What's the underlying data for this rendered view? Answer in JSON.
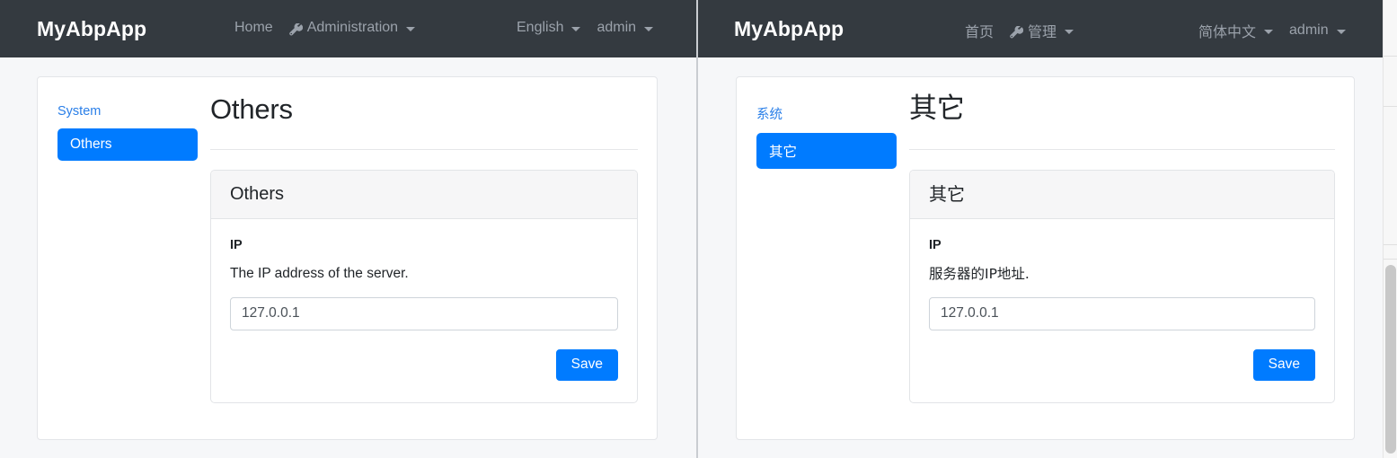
{
  "panes": [
    {
      "id": "english",
      "navbar": {
        "brand": "MyAbpApp",
        "home_label": "Home",
        "admin_menu_label": "Administration",
        "admin_menu_icon": "wrench-icon",
        "language_label": "English",
        "user_label": "admin"
      },
      "settings_nav": {
        "group_title": "System",
        "active_item": "Others"
      },
      "page_title": "Others",
      "card": {
        "header": "Others",
        "field_label": "IP",
        "field_description": "The IP address of the server.",
        "input_value": "127.0.0.1",
        "input_placeholder": "127.0.0.1",
        "save_label": "Save"
      }
    },
    {
      "id": "chinese",
      "navbar": {
        "brand": "MyAbpApp",
        "home_label": "首页",
        "admin_menu_label": "管理",
        "admin_menu_icon": "wrench-icon",
        "language_label": "简体中文",
        "user_label": "admin"
      },
      "settings_nav": {
        "group_title": "系统",
        "active_item": "其它"
      },
      "page_title": "其它",
      "card": {
        "header": "其它",
        "field_label": "IP",
        "field_description": "服务器的IP地址.",
        "input_value": "127.0.0.1",
        "input_placeholder": "127.0.0.1",
        "save_label": "Save"
      }
    }
  ],
  "colors": {
    "navbar_bg": "#343a40",
    "navbar_text": "#9ba2ab",
    "primary": "#007bff",
    "link": "#2a7fe8",
    "page_bg": "#f6f7f9",
    "card_bg": "#ffffff",
    "card_header_bg": "#f6f6f7",
    "border": "#e2e4e7"
  }
}
